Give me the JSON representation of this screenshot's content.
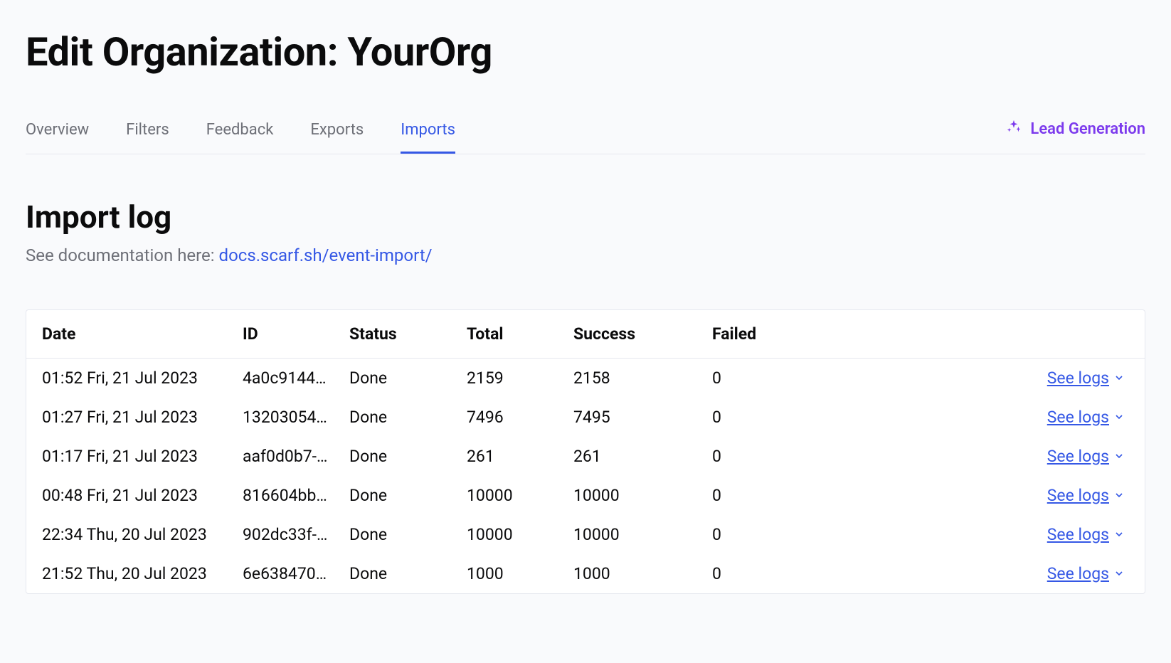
{
  "page_title": "Edit Organization: YourOrg",
  "tabs": {
    "items": [
      {
        "label": "Overview",
        "active": false
      },
      {
        "label": "Filters",
        "active": false
      },
      {
        "label": "Feedback",
        "active": false
      },
      {
        "label": "Exports",
        "active": false
      },
      {
        "label": "Imports",
        "active": true
      }
    ],
    "lead_generation_label": "Lead Generation"
  },
  "section": {
    "title": "Import log",
    "doc_prefix": "See documentation here: ",
    "doc_link_text": "docs.scarf.sh/event-import/"
  },
  "table": {
    "headers": {
      "date": "Date",
      "id": "ID",
      "status": "Status",
      "total": "Total",
      "success": "Success",
      "failed": "Failed"
    },
    "see_logs_label": "See logs",
    "rows": [
      {
        "date": "01:52 Fri, 21 Jul 2023",
        "id": "4a0c9144-…",
        "status": "Done",
        "total": "2159",
        "success": "2158",
        "failed": "0"
      },
      {
        "date": "01:27 Fri, 21 Jul 2023",
        "id": "13203054-…",
        "status": "Done",
        "total": "7496",
        "success": "7495",
        "failed": "0"
      },
      {
        "date": "01:17 Fri, 21 Jul 2023",
        "id": "aaf0d0b7-…",
        "status": "Done",
        "total": "261",
        "success": "261",
        "failed": "0"
      },
      {
        "date": "00:48 Fri, 21 Jul 2023",
        "id": "816604bb-…",
        "status": "Done",
        "total": "10000",
        "success": "10000",
        "failed": "0"
      },
      {
        "date": "22:34 Thu, 20 Jul 2023",
        "id": "902dc33f-…",
        "status": "Done",
        "total": "10000",
        "success": "10000",
        "failed": "0"
      },
      {
        "date": "21:52 Thu, 20 Jul 2023",
        "id": "6e638470-…",
        "status": "Done",
        "total": "1000",
        "success": "1000",
        "failed": "0"
      }
    ]
  }
}
